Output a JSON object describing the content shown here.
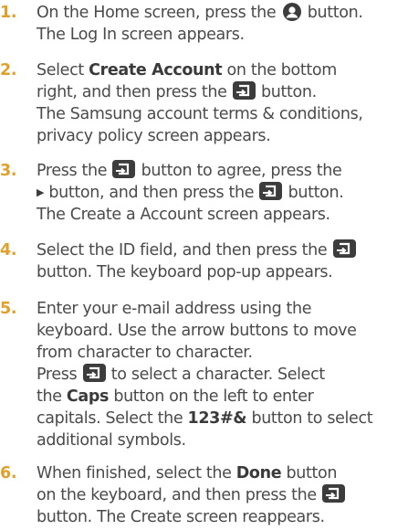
{
  "steps": [
    {
      "num": "1.",
      "lines": {
        "s1a": "On the Home screen, press the",
        "s1b": "button.",
        "s1c": "The Log In screen appears."
      }
    },
    {
      "num": "2.",
      "lines": {
        "s2a": "Select",
        "s2b": "Create Account",
        "s2c": "on the bottom",
        "s2d": "right, and then press the",
        "s2e": "button.",
        "s2f": "The Samsung account terms & conditions,",
        "s2g": "privacy policy screen appears."
      }
    },
    {
      "num": "3.",
      "lines": {
        "s3a": "Press the",
        "s3b": "button to agree, press the",
        "s3c": "button, and then press the",
        "s3d": "button.",
        "s3e": "The Create a Account screen appears."
      }
    },
    {
      "num": "4.",
      "lines": {
        "s4a": "Select the ID field, and then press the",
        "s4b": "button. The keyboard pop-up appears."
      }
    },
    {
      "num": "5.",
      "lines": {
        "s5a": "Enter your e-mail address using the",
        "s5b": "keyboard. Use the arrow buttons to move",
        "s5c": "from character to character.",
        "s5d": "Press",
        "s5e": "to select a character. Select",
        "s5f": "the",
        "s5g": "Caps",
        "s5h": "button on the left to enter",
        "s5i": "capitals. Select the",
        "s5j": "123#&",
        "s5k": "button to select",
        "s5l": "additional symbols."
      }
    },
    {
      "num": "6.",
      "lines": {
        "s6a": "When finished, select the",
        "s6b": "Done",
        "s6c": "button",
        "s6d": "on the keyboard, and then press the",
        "s6e": "button. The Create screen reappears."
      }
    }
  ],
  "icons": {
    "account": "account-icon",
    "enter": "enter-icon",
    "right_arrow": "right-arrow-icon"
  },
  "colors": {
    "step_number": "#e0a02b",
    "text": "#4a4a4a",
    "icon": "#3c3c3c"
  }
}
